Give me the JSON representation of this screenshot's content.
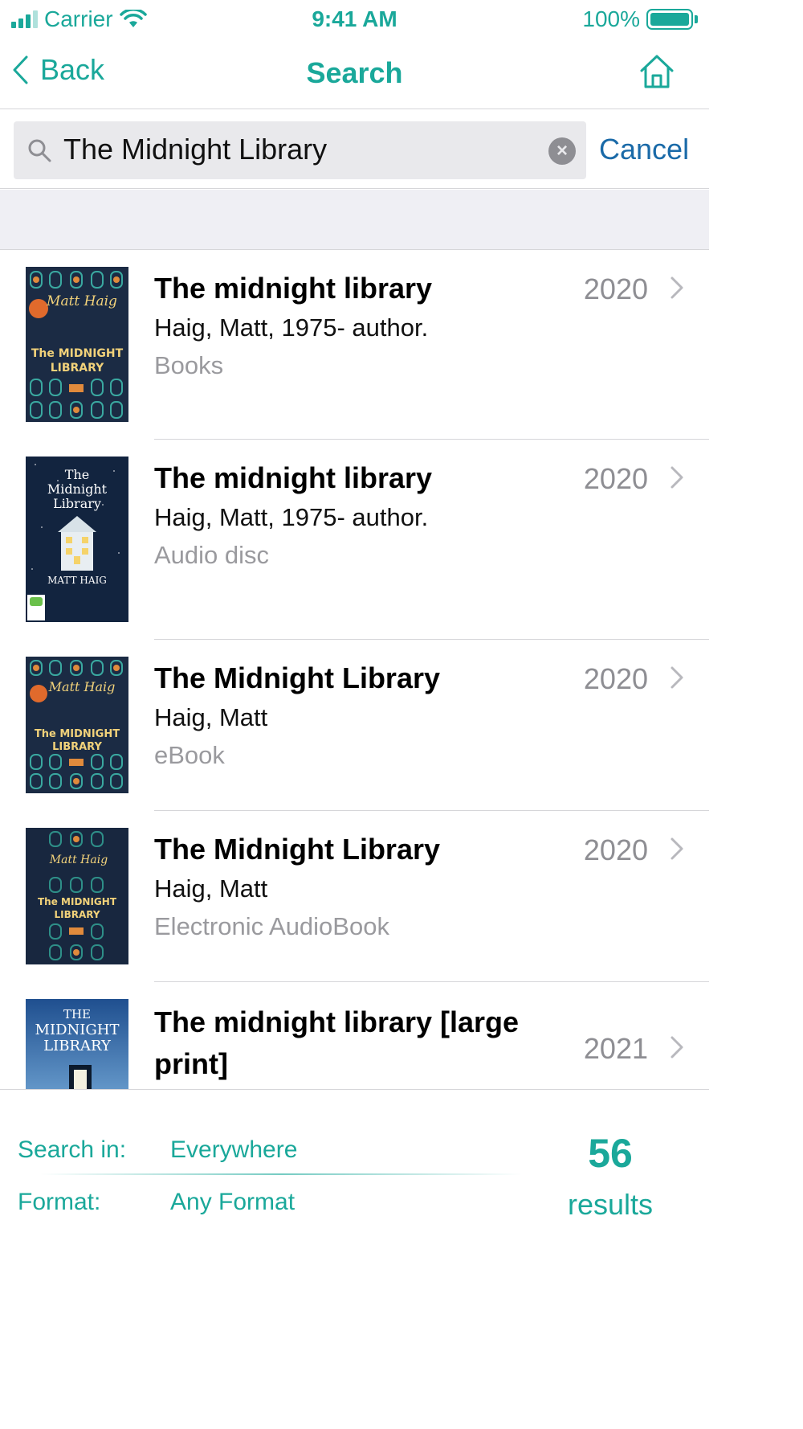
{
  "status_bar": {
    "carrier": "Carrier",
    "time": "9:41 AM",
    "battery": "100%"
  },
  "nav": {
    "back_label": "Back",
    "title": "Search",
    "home_icon": "home-icon"
  },
  "search": {
    "value": "The Midnight Library",
    "cancel_label": "Cancel"
  },
  "results": [
    {
      "title": "The midnight library",
      "author": "Haig, Matt, 1975- author.",
      "format": "Books",
      "year": "2020"
    },
    {
      "title": "The midnight library",
      "author": "Haig, Matt, 1975- author.",
      "format": "Audio disc",
      "year": "2020"
    },
    {
      "title": "The Midnight Library",
      "author": "Haig, Matt",
      "format": "eBook",
      "year": "2020"
    },
    {
      "title": "The Midnight Library",
      "author": "Haig, Matt",
      "format": "Electronic AudioBook",
      "year": "2020"
    },
    {
      "title": "The midnight library [large print]",
      "author": "",
      "format": "",
      "year": "2021"
    }
  ],
  "covers": {
    "matt_haig_script": "Matt Haig",
    "the_midnight": "The MIDNIGHT",
    "library": "LIBRARY",
    "audio_title_1": "The",
    "audio_title_2": "Midnight",
    "audio_title_3": "Library",
    "audio_author": "MATT HAIG",
    "lp_the": "THE",
    "lp_midnight": "MIDNIGHT",
    "lp_library": "LIBRARY"
  },
  "footer": {
    "search_in_label": "Search in:",
    "search_in_value": "Everywhere",
    "format_label": "Format:",
    "format_value": "Any Format",
    "count": "56",
    "count_label": "results"
  },
  "colors": {
    "accent": "#1aa89a",
    "link_blue": "#1a6aa8",
    "secondary_text": "#8e8e93"
  }
}
